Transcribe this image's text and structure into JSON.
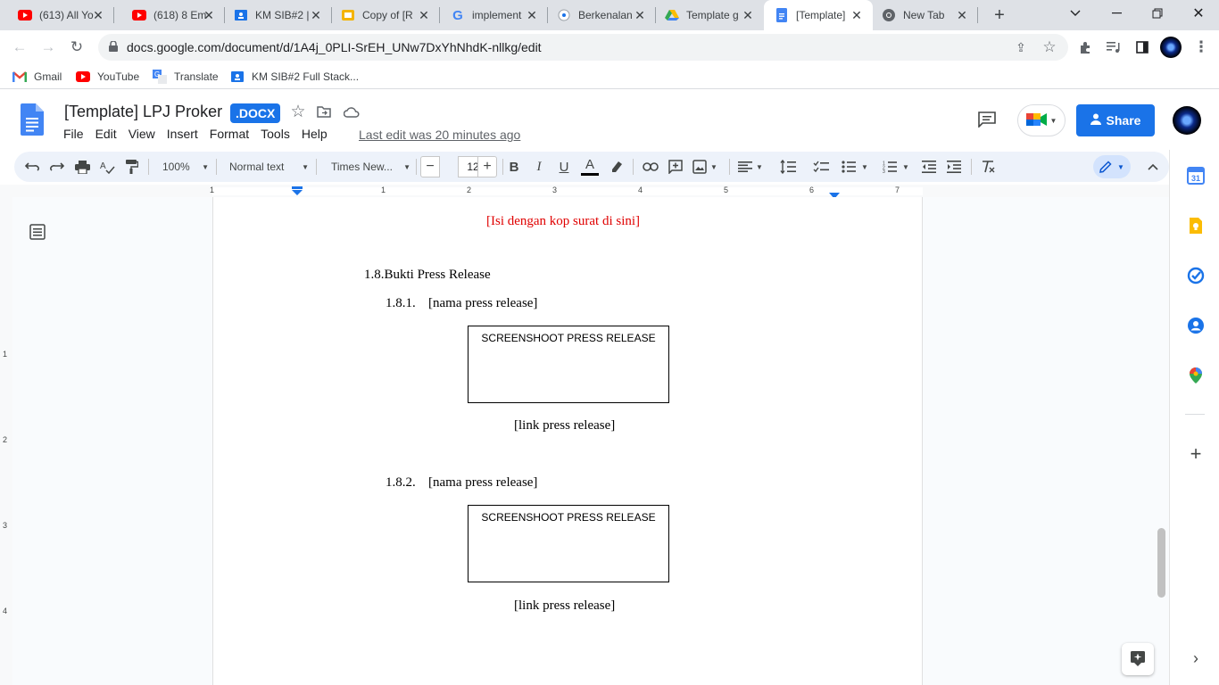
{
  "browser": {
    "tabs": [
      {
        "title": "(613) All Yo",
        "icon": "youtube-icon"
      },
      {
        "title": "(618) 8 Em",
        "icon": "youtube-icon"
      },
      {
        "title": "KM SIB#2 |",
        "icon": "classroom-icon"
      },
      {
        "title": "Copy of [R",
        "icon": "slides-icon"
      },
      {
        "title": "implement",
        "icon": "google-icon"
      },
      {
        "title": "Berkenalan",
        "icon": "site-icon"
      },
      {
        "title": "Template g",
        "icon": "drive-icon"
      },
      {
        "title": "[Template]",
        "icon": "docs-icon"
      },
      {
        "title": "New Tab",
        "icon": "chrome-icon"
      }
    ],
    "active_tab": 7,
    "url": "docs.google.com/document/d/1A4j_0PLI-SrEH_UNw7DxYhNhdK-nllkg/edit",
    "bookmarks": [
      {
        "label": "Gmail",
        "icon": "gmail-icon"
      },
      {
        "label": "YouTube",
        "icon": "youtube-icon"
      },
      {
        "label": "Translate",
        "icon": "translate-icon"
      },
      {
        "label": "KM SIB#2 Full Stack...",
        "icon": "classroom-icon"
      }
    ]
  },
  "docs": {
    "title": "[Template] LPJ Proker",
    "badge": ".DOCX",
    "menu": [
      "File",
      "Edit",
      "View",
      "Insert",
      "Format",
      "Tools",
      "Help"
    ],
    "last_edit": "Last edit was 20 minutes ago",
    "share_label": "Share"
  },
  "toolbar": {
    "zoom": "100%",
    "style": "Normal text",
    "font": "Times New...",
    "font_size": "12"
  },
  "ruler": {
    "labels": [
      "1",
      "1",
      "2",
      "3",
      "4",
      "5",
      "6",
      "7"
    ]
  },
  "vruler": {
    "labels": [
      "1",
      "2",
      "3",
      "4"
    ]
  },
  "document": {
    "kop": "[Isi dengan kop surat di sini]",
    "section_number": "1.8.",
    "section_title": "Bukti Press Release",
    "items": [
      {
        "number": "1.8.1.",
        "name": "[nama press release]",
        "box": "SCREENSHOOT PRESS RELEASE",
        "link": "[link press release]"
      },
      {
        "number": "1.8.2.",
        "name": "[nama press release]",
        "box": "SCREENSHOOT PRESS RELEASE",
        "link": "[link press release]"
      }
    ]
  },
  "colors": {
    "accent": "#1a73e8",
    "kop_text": "#e00000",
    "toolbar_bg": "#edf2fa"
  }
}
